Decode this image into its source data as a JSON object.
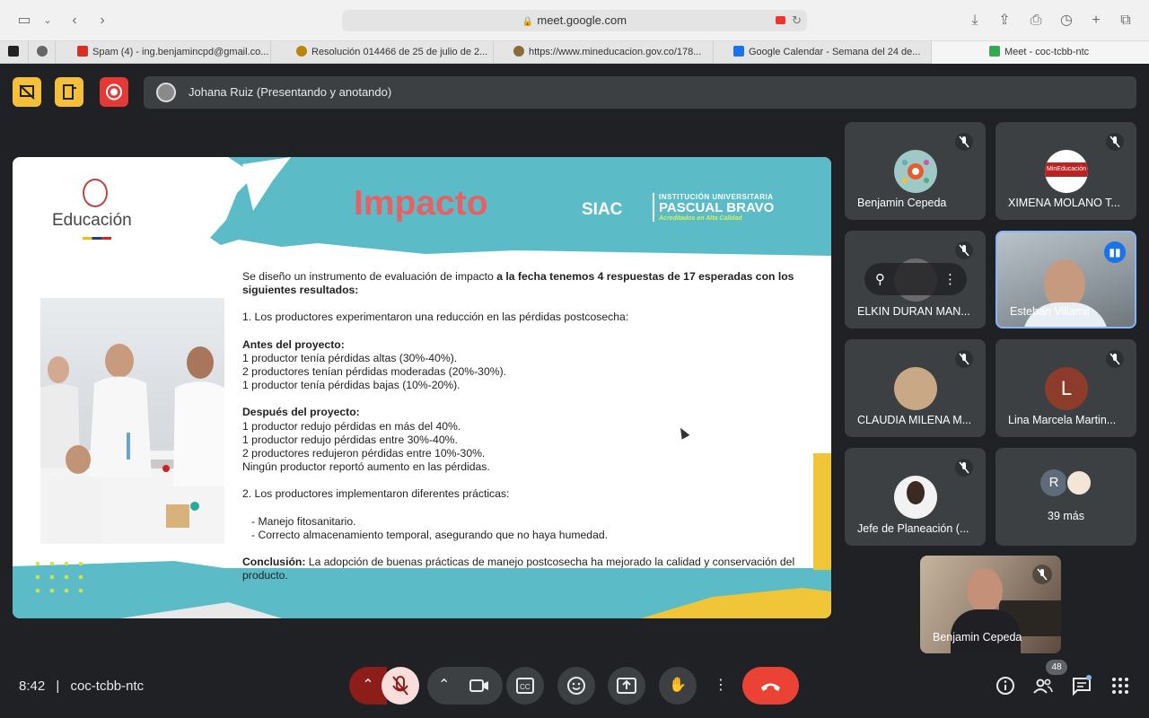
{
  "browser": {
    "url": "meet.google.com",
    "tabs": [
      {
        "label": "Spam (4) - ing.benjamincpd@gmail.co...",
        "fav_color": "#d93025"
      },
      {
        "label": "Resolución 014466 de 25 de julio de 2...",
        "fav_color": "#b8860b"
      },
      {
        "label": "https://www.mineducacion.gov.co/178...",
        "fav_color": "#8b6a3e"
      },
      {
        "label": "Google Calendar - Semana del 24 de...",
        "fav_color": "#1a73e8"
      },
      {
        "label": "Meet - coc-tcbb-ntc",
        "fav_color": "#34a853"
      }
    ]
  },
  "meet": {
    "presenter": "Johana Ruiz (Presentando y anotando)",
    "time": "8:42",
    "separator": "|",
    "meeting_code": "coc-tcbb-ntc",
    "people_count": "48"
  },
  "slide": {
    "title": "Impacto",
    "logo_text": "Educación",
    "siac": "SIAC",
    "inst_line1": "INSTITUCIÓN UNIVERSITARIA",
    "inst_line2": "PASCUAL BRAVO",
    "inst_line3": "Acreditados en Alta Calidad",
    "intro_normal": "Se diseño un instrumento de evaluación de impacto ",
    "intro_bold": "a la fecha tenemos 4 respuestas de 17 esperadas con los siguientes resultados:",
    "point1": "1. Los productores experimentaron una reducción en las pérdidas postcosecha:",
    "before_heading": "Antes del proyecto:",
    "before": [
      "1 productor tenía pérdidas altas (30%-40%).",
      "2 productores tenían pérdidas moderadas (20%-30%).",
      "1 productor tenía pérdidas bajas (10%-20%)."
    ],
    "after_heading": "Después del proyecto:",
    "after": [
      "1 productor redujo pérdidas en más del 40%.",
      "1 productor redujo pérdidas entre 30%-40%.",
      "2 productores redujeron pérdidas entre 10%-30%.",
      "Ningún productor reportó aumento en las pérdidas."
    ],
    "point2": "2. Los productores implementaron diferentes prácticas:",
    "practices": [
      "- Manejo fitosanitario.",
      "- Correcto almacenamiento temporal, asegurando que no haya humedad."
    ],
    "conclusion_label": "Conclusión:",
    "conclusion_text": " La adopción de buenas prácticas de manejo postcosecha ha mejorado la calidad y conservación del producto."
  },
  "participants": [
    {
      "name": "Benjamin Cepeda",
      "avatar_color": "#9ec9c7",
      "initial": ""
    },
    {
      "name": "XIMENA MOLANO T...",
      "avatar_color": "#ffffff",
      "initial": "",
      "logo_text": "MinEducación"
    },
    {
      "name": "ELKIN DURAN MAN...",
      "avatar_color": "#6b6b6b",
      "initial": ""
    },
    {
      "name": "Esteban Villamil",
      "avatar_color": "#8a8f96",
      "initial": ""
    },
    {
      "name": "CLAUDIA MILENA M...",
      "avatar_color": "#c9a886",
      "initial": ""
    },
    {
      "name": "Lina Marcela Martin...",
      "avatar_color": "#8d3b2b",
      "initial": "L"
    },
    {
      "name": "Jefe de Planeación (...",
      "avatar_color": "#e8e8e8",
      "initial": ""
    }
  ],
  "more": {
    "label": "39 más",
    "initial": "R"
  },
  "self": {
    "name": "Benjamin Cepeda"
  }
}
